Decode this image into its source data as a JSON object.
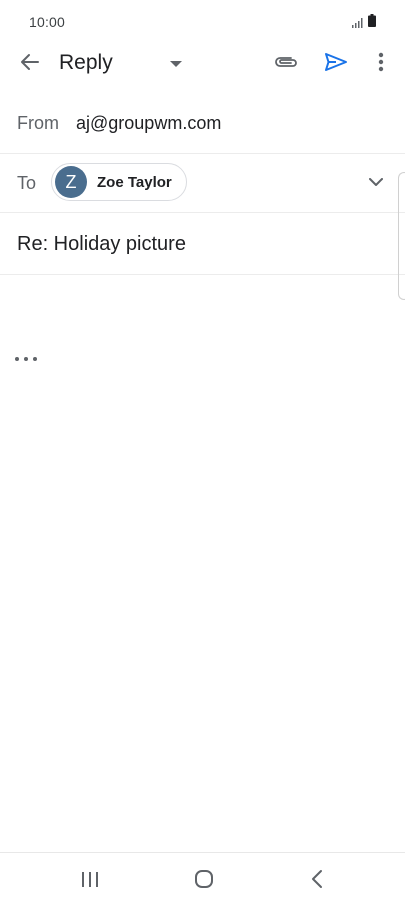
{
  "status_bar": {
    "time": "10:00"
  },
  "app_bar": {
    "title": "Reply",
    "icons": {
      "back": "arrow-back-icon",
      "dropdown": "dropdown-triangle-icon",
      "attach": "paperclip-icon",
      "send": "send-icon",
      "more": "more-vert-icon"
    }
  },
  "compose": {
    "from_label": "From",
    "from_value": "aj@groupwm.com",
    "to_label": "To",
    "recipient": {
      "initial": "Z",
      "name": "Zoe Taylor"
    },
    "subject": "Re: Holiday picture"
  },
  "colors": {
    "send_accent": "#1a73e8",
    "avatar_bg": "#4a6d8e"
  },
  "nav_bar": {
    "icons": [
      "recents-icon",
      "home-icon",
      "back-icon"
    ]
  }
}
